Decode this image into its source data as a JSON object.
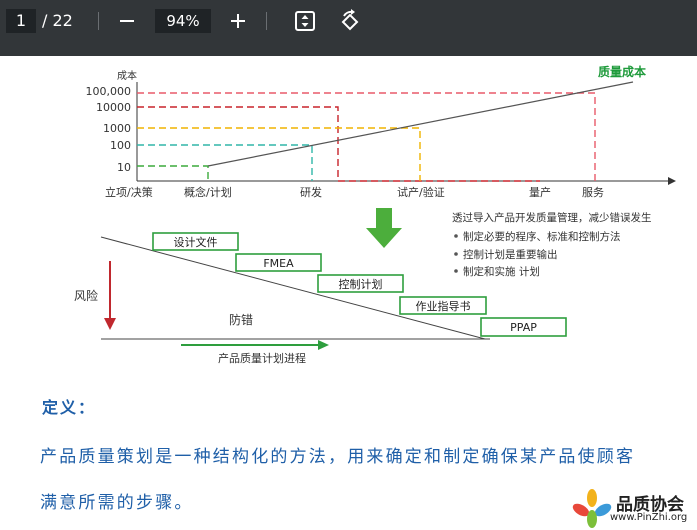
{
  "toolbar": {
    "current_page": "1",
    "page_total": "/ 22",
    "zoom": "94%",
    "icons": [
      "minus-icon",
      "plus-icon",
      "fit-page-icon",
      "rotate-icon"
    ]
  },
  "diagram": {
    "cost_axis_label": "成本",
    "quality_cost_label": "质量成本",
    "y_ticks": [
      "100,000",
      "10000",
      "1000",
      "100",
      "10"
    ],
    "x_stages": [
      "立项/决策",
      "概念/计划",
      "研发",
      "试产/验证",
      "量产",
      "服务"
    ],
    "notes_title": "透过导入产品开发质量管理，减少错误发生",
    "notes": [
      "制定必要的程序、标准和控制方法",
      "控制计划是重要输出",
      "制定和实施 计划"
    ],
    "steps": [
      "设计文件",
      "FMEA",
      "控制计划",
      "作业指导书",
      "PPAP"
    ],
    "risk_label": "风险",
    "prevention_label": "防错",
    "progress_label": "产品质量计划进程",
    "colors": {
      "red": "#c8232b",
      "orange": "#f0b400",
      "teal": "#30b6a8",
      "green": "#3caa3c",
      "green_text": "#1d9a3a"
    }
  },
  "definition": {
    "title": "定义：",
    "line1": "产品质量策划是一种结构化的方法，用来确定和制定确保某产品使顾客",
    "line2": "满意所需的步骤。"
  },
  "watermark": {
    "name": "品质协会",
    "url": "www.PinZhi.org"
  }
}
